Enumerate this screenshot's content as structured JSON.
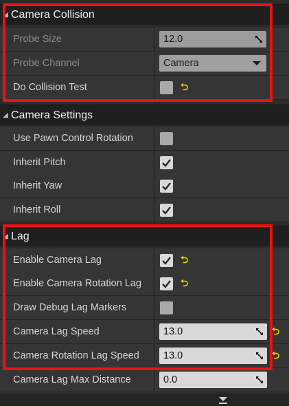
{
  "sections": {
    "camera_collision": {
      "title": "Camera Collision",
      "probe_size": {
        "label": "Probe Size",
        "value": "12.0"
      },
      "probe_channel": {
        "label": "Probe Channel",
        "value": "Camera"
      },
      "do_collision_test": {
        "label": "Do Collision Test",
        "checked": false
      }
    },
    "camera_settings": {
      "title": "Camera Settings",
      "use_pawn_control_rotation": {
        "label": "Use Pawn Control Rotation",
        "checked": false
      },
      "inherit_pitch": {
        "label": "Inherit Pitch",
        "checked": true
      },
      "inherit_yaw": {
        "label": "Inherit Yaw",
        "checked": true
      },
      "inherit_roll": {
        "label": "Inherit Roll",
        "checked": true
      }
    },
    "lag": {
      "title": "Lag",
      "enable_camera_lag": {
        "label": "Enable Camera Lag",
        "checked": true
      },
      "enable_camera_rotation_lag": {
        "label": "Enable Camera Rotation Lag",
        "checked": true
      },
      "draw_debug_lag_markers": {
        "label": "Draw Debug Lag Markers",
        "checked": false
      },
      "camera_lag_speed": {
        "label": "Camera Lag Speed",
        "value": "13.0"
      },
      "camera_rotation_lag_speed": {
        "label": "Camera Rotation Lag Speed",
        "value": "13.0"
      },
      "camera_lag_max_distance": {
        "label": "Camera Lag Max Distance",
        "value": "0.0"
      }
    }
  },
  "colors": {
    "highlight": "#ee1111",
    "reset_arrow": "#e8d400",
    "panel_bg": "#353535",
    "header_bg": "#1f1f1f"
  },
  "icons": {
    "reset": "reset-to-default-icon",
    "expand": "expand-arrow-icon",
    "drag": "drag-handle-icon",
    "check": "check-icon"
  }
}
